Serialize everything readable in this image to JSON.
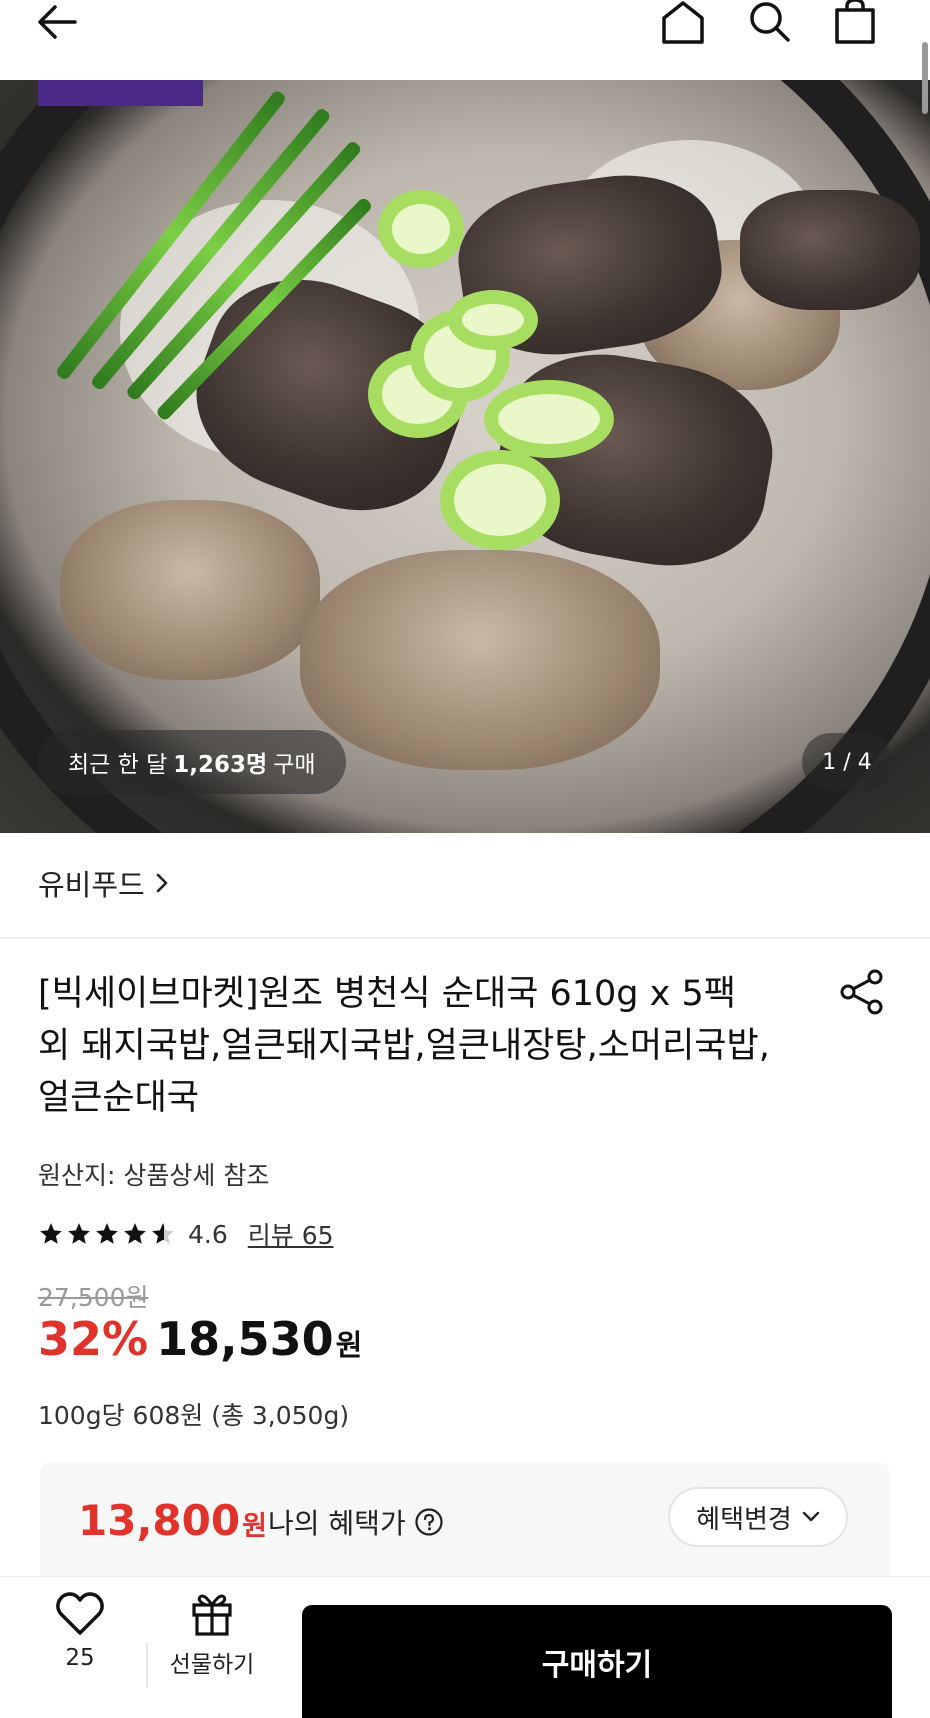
{
  "product": {
    "recent_purchase_prefix": "최근 한 달",
    "recent_purchase_count": "1,263명",
    "recent_purchase_suffix": "구매",
    "image_page": "1 / 4",
    "seller": "유비푸드",
    "title": "[빅세이브마켓]원조 병천식 순대국 610g x 5팩 외 돼지국밥,얼큰돼지국밥,얼큰내장탕,소머리국밥,얼큰순대국",
    "origin": "원산지: 상품상세 참조",
    "rating": "4.6",
    "rating_value": 4.6,
    "review_link": "리뷰 65",
    "original_price": "27,500원",
    "discount": "32%",
    "price": "18,530",
    "price_unit": "원",
    "unit_price": "100g당 608원 (총 3,050g)"
  },
  "benefit": {
    "price": "13,800",
    "price_unit": "원",
    "label": "나의 혜택가",
    "change_button": "혜택변경"
  },
  "bottom_bar": {
    "like_count": "25",
    "gift_label": "선물하기",
    "buy_label": "구매하기"
  },
  "icons": {
    "back": "arrow-left-icon",
    "home": "home-icon",
    "search": "search-icon",
    "cart": "shopping-bag-icon",
    "share": "share-icon",
    "help": "question-circle-icon",
    "chevron": "chevron-down-icon",
    "like": "heart-icon",
    "gift": "gift-icon"
  },
  "colors": {
    "discount_red": "#e0332b",
    "buy_button": "#000000",
    "brand_purple": "#4a2a86"
  }
}
